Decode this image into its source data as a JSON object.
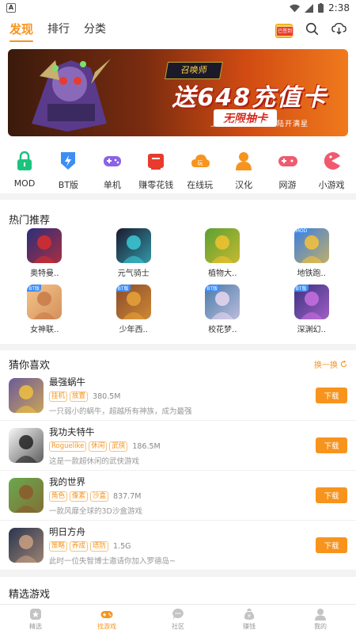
{
  "status": {
    "time": "2:38",
    "left_badge": "A"
  },
  "nav": {
    "tabs": [
      {
        "label": "发现",
        "active": true
      },
      {
        "label": "排行",
        "active": false
      },
      {
        "label": "分类",
        "active": false
      }
    ],
    "signin_tag": "已签到"
  },
  "banner": {
    "game_label": "召唤师",
    "headline": "送648充值卡",
    "ribbon": "无限抽卡",
    "sub": "上线送剑圣 持续登陆开满星"
  },
  "categories": [
    {
      "label": "MOD",
      "color": "#1bc47d",
      "icon": "lock-icon"
    },
    {
      "label": "BT版",
      "color": "#3d8df5",
      "icon": "bolt-icon"
    },
    {
      "label": "单机",
      "color": "#8a63e8",
      "icon": "gamepad-icon"
    },
    {
      "label": "赚零花钱",
      "color": "#e83b2e",
      "icon": "wallet-icon"
    },
    {
      "label": "在线玩",
      "color": "#f7941d",
      "icon": "cloud-icon"
    },
    {
      "label": "汉化",
      "color": "#f7941d",
      "icon": "person-icon"
    },
    {
      "label": "网游",
      "color": "#ef5a6f",
      "icon": "controller-icon"
    },
    {
      "label": "小游戏",
      "color": "#ef5a6f",
      "icon": "pacman-icon"
    }
  ],
  "hot": {
    "title": "热门推荐",
    "items": [
      {
        "name": "奥特曼..",
        "color": "#2b2f7a",
        "accent": "#d92d2d",
        "badge": ""
      },
      {
        "name": "元气骑士",
        "color": "#1a1a2e",
        "accent": "#3cc9d6",
        "badge": ""
      },
      {
        "name": "植物大..",
        "color": "#5aa132",
        "accent": "#f2c230",
        "badge": ""
      },
      {
        "name": "地铁跑..",
        "color": "#3b7ee0",
        "accent": "#f5c23a",
        "badge": "MOD"
      },
      {
        "name": "女神联..",
        "color": "#f4c58a",
        "accent": "#c87b4a",
        "badge": "BT版"
      },
      {
        "name": "少年西..",
        "color": "#8b4a2a",
        "accent": "#e8a23a",
        "badge": "BT版"
      },
      {
        "name": "校花梦..",
        "color": "#4a7aa8",
        "accent": "#e8d7f0",
        "badge": "BT版"
      },
      {
        "name": "深渊幻..",
        "color": "#3a3380",
        "accent": "#c870e0",
        "badge": "BT版"
      }
    ]
  },
  "guess": {
    "title": "猜你喜欢",
    "refresh": "换一换",
    "items": [
      {
        "name": "最强蜗牛",
        "tags": [
          "挂机",
          "放置"
        ],
        "size": "380.5M",
        "desc": "一只弱小的蜗牛，超越所有神族，成为最强",
        "color": "#6b5a9a",
        "accent": "#f0c040",
        "button": "下载"
      },
      {
        "name": "我功夫特牛",
        "tags": [
          "Roguelike",
          "休闲",
          "武侠"
        ],
        "size": "186.5M",
        "desc": "这是一款超休闲的武侠游戏",
        "color": "#f7f7f7",
        "accent": "#222222",
        "button": "下载"
      },
      {
        "name": "我的世界",
        "tags": [
          "角色",
          "像素",
          "沙盒"
        ],
        "size": "837.7M",
        "desc": "一款风靡全球的3D沙盒游戏",
        "color": "#6aa84f",
        "accent": "#8b5a2b",
        "button": "下载"
      },
      {
        "name": "明日方舟",
        "tags": [
          "策略",
          "养成",
          "塔防"
        ],
        "size": "1.5G",
        "desc": "此时一位失智博士邀请你加入罗德岛~",
        "color": "#2a3550",
        "accent": "#c8a080",
        "button": "下载"
      }
    ]
  },
  "picks": {
    "title": "精选游戏",
    "colors": [
      "#6a5a40",
      "#7a6ab0",
      "#8aa0c8",
      "#e8a030"
    ]
  },
  "bottomnav": [
    {
      "label": "精选",
      "icon": "star-icon",
      "active": false
    },
    {
      "label": "找游戏",
      "icon": "gamepad-icon",
      "active": true
    },
    {
      "label": "社区",
      "icon": "chat-icon",
      "active": false
    },
    {
      "label": "赚钱",
      "icon": "money-bag-icon",
      "active": false
    },
    {
      "label": "我的",
      "icon": "user-icon",
      "active": false
    }
  ]
}
